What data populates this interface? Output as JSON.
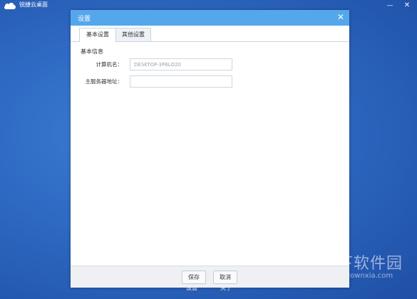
{
  "app": {
    "title": "锐捷云桌面",
    "minimize_glyph": "—",
    "close_glyph": "✕"
  },
  "background_labels": {
    "settings": "设置",
    "about": "关于"
  },
  "dialog": {
    "title": "设置",
    "close_glyph": "✕",
    "tabs": [
      {
        "label": "基本设置",
        "active": true
      },
      {
        "label": "其他设置",
        "active": false
      }
    ],
    "section_title": "基本信息",
    "fields": {
      "computer_name": {
        "label": "计算机名：",
        "value": "DESKTOP-3P6LO20"
      },
      "main_server": {
        "label": "主服务器地址：",
        "value": ""
      }
    },
    "buttons": {
      "save": "保存",
      "cancel": "取消"
    }
  },
  "watermark": {
    "text": "当下软件园",
    "url": "www.downxia.com"
  },
  "colors": {
    "accent": "#55a7ec",
    "desktop": "#2f6bc4"
  }
}
